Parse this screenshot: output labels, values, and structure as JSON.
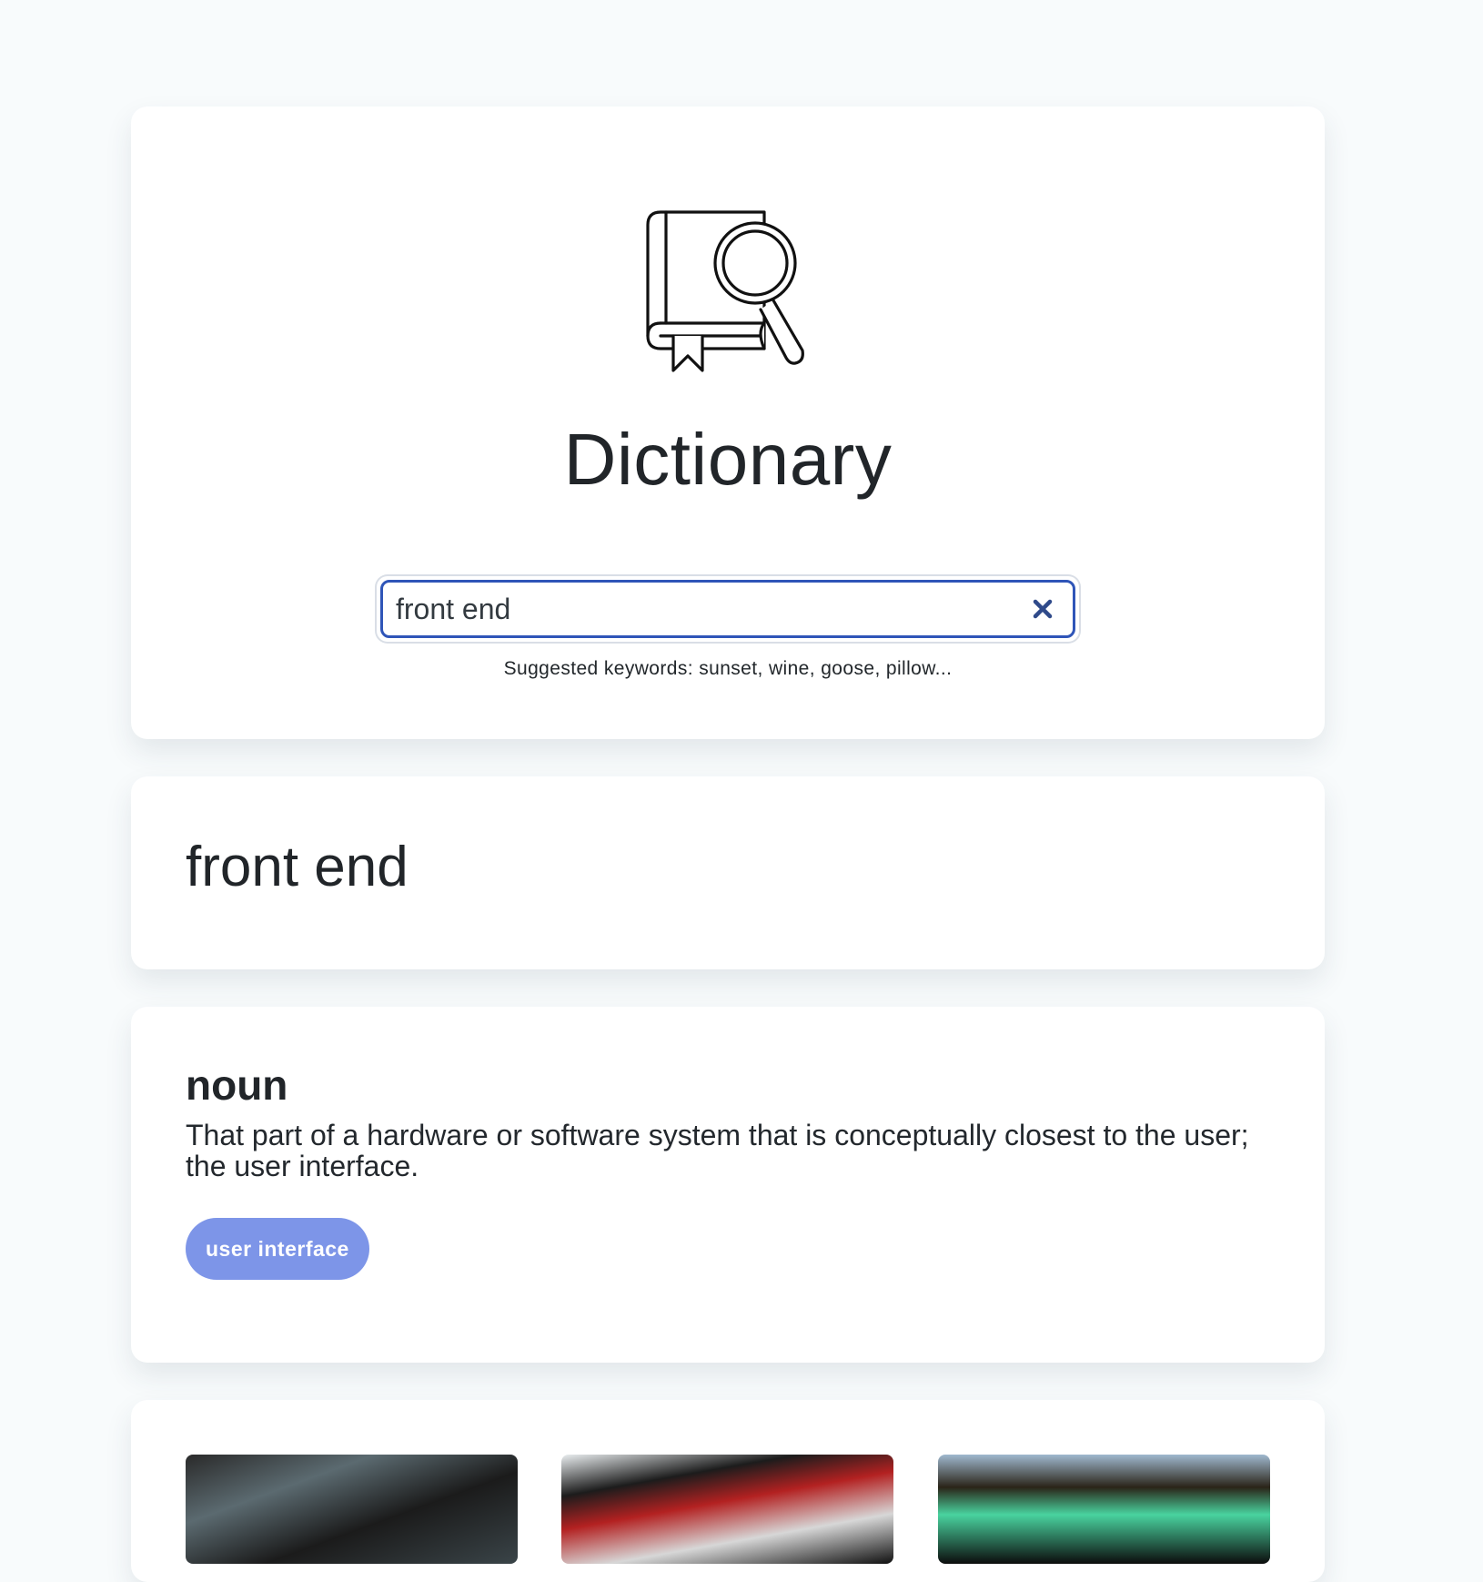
{
  "app": {
    "title": "Dictionary",
    "logo_icon": "book-magnifier-icon"
  },
  "search": {
    "value": "front end",
    "clear_icon": "close-icon",
    "suggestions_text": "Suggested keywords: sunset, wine, goose, pillow..."
  },
  "result": {
    "word": "front end",
    "meanings": [
      {
        "part_of_speech": "noun",
        "definition": "That part of a hardware or software system that is conceptually closest to the user; the user interface.",
        "synonyms": [
          "user interface"
        ]
      }
    ]
  },
  "photos": [
    {
      "icon": "photo-thumbnail"
    },
    {
      "icon": "photo-thumbnail"
    },
    {
      "icon": "photo-thumbnail"
    }
  ],
  "colors": {
    "background": "#f8fbfc",
    "accent": "#2f55b8",
    "synonym_badge": "#7d95e8",
    "text": "#212529"
  }
}
